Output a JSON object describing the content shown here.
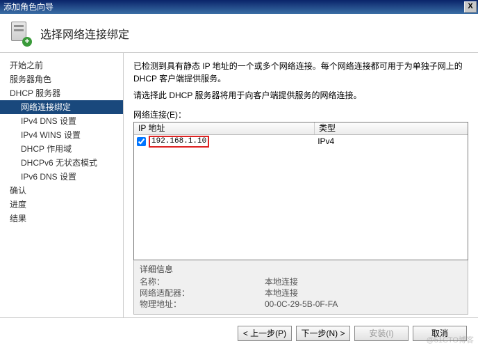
{
  "window": {
    "title": "添加角色向导"
  },
  "header": {
    "title": "选择网络连接绑定"
  },
  "sidebar": {
    "items": [
      {
        "label": "开始之前",
        "sub": false,
        "selected": false
      },
      {
        "label": "服务器角色",
        "sub": false,
        "selected": false
      },
      {
        "label": "DHCP 服务器",
        "sub": false,
        "selected": false
      },
      {
        "label": "网络连接绑定",
        "sub": true,
        "selected": true
      },
      {
        "label": "IPv4 DNS 设置",
        "sub": true,
        "selected": false
      },
      {
        "label": "IPv4 WINS 设置",
        "sub": true,
        "selected": false
      },
      {
        "label": "DHCP 作用域",
        "sub": true,
        "selected": false
      },
      {
        "label": "DHCPv6 无状态模式",
        "sub": true,
        "selected": false
      },
      {
        "label": "IPv6 DNS 设置",
        "sub": true,
        "selected": false
      },
      {
        "label": "确认",
        "sub": false,
        "selected": false
      },
      {
        "label": "进度",
        "sub": false,
        "selected": false
      },
      {
        "label": "结果",
        "sub": false,
        "selected": false
      }
    ]
  },
  "content": {
    "desc1": "已检测到具有静态 IP 地址的一个或多个网络连接。每个网络连接都可用于为单独子网上的 DHCP 客户端提供服务。",
    "desc2": "请选择此 DHCP 服务器将用于向客户端提供服务的网络连接。",
    "list_label": "网络连接(E)：",
    "columns": {
      "ip": "IP 地址",
      "type": "类型"
    },
    "rows": [
      {
        "checked": true,
        "ip": "192.168.1.10",
        "type": "IPv4",
        "highlight": true
      }
    ],
    "details": {
      "title": "详细信息",
      "name_label": "名称：",
      "name_value": "本地连接",
      "adapter_label": "网络适配器：",
      "adapter_value": "本地连接",
      "mac_label": "物理地址：",
      "mac_value": "00-0C-29-5B-0F-FA"
    }
  },
  "footer": {
    "prev": "< 上一步(P)",
    "next": "下一步(N) >",
    "install": "安装(I)",
    "cancel": "取消"
  },
  "watermark": "@51CTO博客"
}
